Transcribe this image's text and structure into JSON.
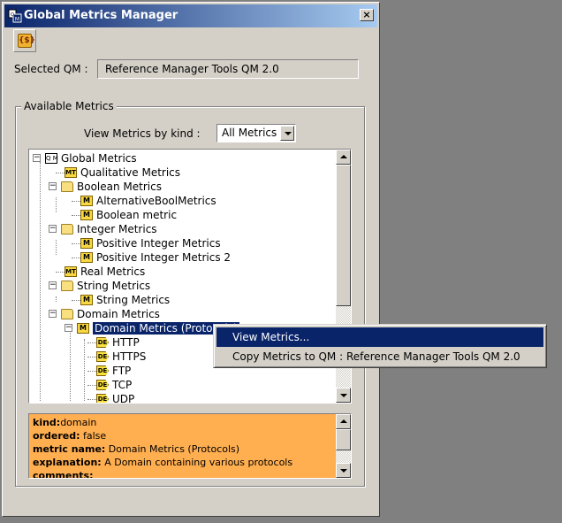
{
  "window": {
    "title": "Global Metrics Manager",
    "close_label": "×",
    "toolbar_icon_label": "{$}"
  },
  "selected_qm": {
    "label": "Selected QM :",
    "value": "Reference Manager Tools QM 2.0"
  },
  "available_metrics": {
    "legend": "Available Metrics",
    "kind_label": "View Metrics by kind :",
    "kind_value": "All Metrics"
  },
  "tree": {
    "nodes": [
      {
        "label": "Global Metrics",
        "icon": "root-icon",
        "icon_text": "Q M"
      },
      {
        "label": "Qualitative Metrics",
        "icon": "metric-type-icon",
        "icon_text": "MT"
      },
      {
        "label": "Boolean Metrics",
        "icon": "folder-icon"
      },
      {
        "label": "AlternativeBoolMetrics",
        "icon": "metric-icon",
        "icon_text": "M"
      },
      {
        "label": "Boolean metric",
        "icon": "metric-icon",
        "icon_text": "M"
      },
      {
        "label": "Integer Metrics",
        "icon": "folder-icon"
      },
      {
        "label": "Positive Integer Metrics",
        "icon": "metric-icon",
        "icon_text": "M"
      },
      {
        "label": "Positive Integer Metrics 2",
        "icon": "metric-icon",
        "icon_text": "M"
      },
      {
        "label": "Real Metrics",
        "icon": "metric-type-icon",
        "icon_text": "MT"
      },
      {
        "label": "String Metrics",
        "icon": "folder-icon"
      },
      {
        "label": "String Metrics",
        "icon": "metric-icon",
        "icon_text": "M"
      },
      {
        "label": "Domain Metrics",
        "icon": "folder-icon"
      },
      {
        "label": "Domain Metrics (Protocols)",
        "icon": "metric-icon",
        "icon_text": "M"
      },
      {
        "label": "HTTP",
        "icon": "domain-element-icon",
        "icon_text": "DE"
      },
      {
        "label": "HTTPS",
        "icon": "domain-element-icon",
        "icon_text": "DE"
      },
      {
        "label": "FTP",
        "icon": "domain-element-icon",
        "icon_text": "DE"
      },
      {
        "label": "TCP",
        "icon": "domain-element-icon",
        "icon_text": "DE"
      },
      {
        "label": "UDP",
        "icon": "domain-element-icon",
        "icon_text": "DE"
      }
    ]
  },
  "info": {
    "lines": [
      {
        "key": "kind:",
        "value": "domain"
      },
      {
        "key": "ordered:",
        "value": " false"
      },
      {
        "key": "metric name:",
        "value": " Domain Metrics (Protocols)"
      },
      {
        "key": "explanation:",
        "value": " A Domain containing various protocols"
      },
      {
        "key": "comments:",
        "value": ""
      }
    ]
  },
  "context_menu": {
    "items": [
      {
        "label": "View Metrics..."
      },
      {
        "label": "Copy Metrics to QM : Reference Manager Tools QM 2.0"
      }
    ]
  },
  "colors": {
    "titlebar_start": "#0a246a",
    "titlebar_end": "#a6caf0",
    "selection": "#0a246a",
    "info_background": "#ffae50",
    "face": "#d4d0c8"
  }
}
